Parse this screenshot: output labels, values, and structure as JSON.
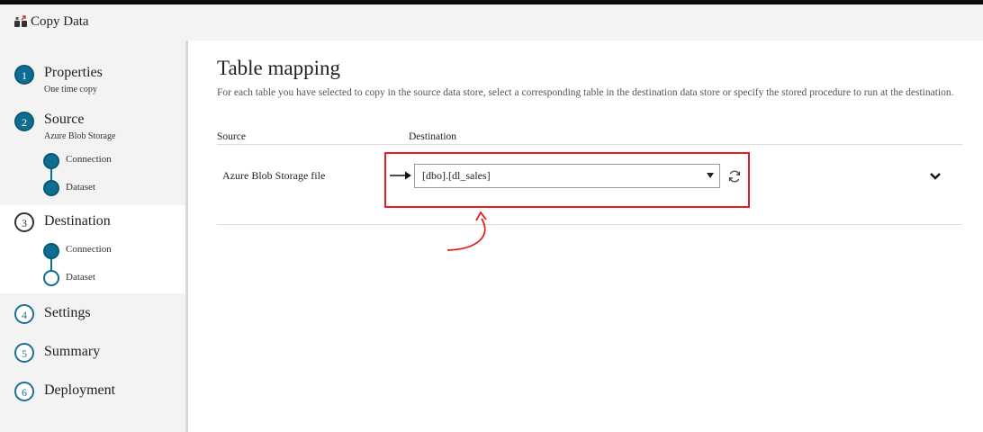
{
  "app": {
    "title": "Copy Data",
    "icon": "copy-data-icon"
  },
  "steps": [
    {
      "number": "1",
      "label": "Properties",
      "sub": "One time copy",
      "state": "complete"
    },
    {
      "number": "2",
      "label": "Source",
      "sub": "Azure Blob Storage",
      "state": "complete",
      "substeps": [
        {
          "label": "Connection",
          "state": "complete"
        },
        {
          "label": "Dataset",
          "state": "complete"
        }
      ]
    },
    {
      "number": "3",
      "label": "Destination",
      "sub": "",
      "state": "current",
      "substeps": [
        {
          "label": "Connection",
          "state": "complete"
        },
        {
          "label": "Dataset",
          "state": "current"
        }
      ]
    },
    {
      "number": "4",
      "label": "Settings",
      "state": "pending"
    },
    {
      "number": "5",
      "label": "Summary",
      "state": "pending"
    },
    {
      "number": "6",
      "label": "Deployment",
      "state": "pending"
    }
  ],
  "main": {
    "title": "Table mapping",
    "description": "For each table you have selected to copy in the source data store, select a corresponding table in the destination data store or specify the stored procedure to run at the destination.",
    "columns": {
      "source": "Source",
      "destination": "Destination"
    },
    "rows": [
      {
        "source": "Azure Blob Storage file",
        "destination": "[dbo].[dl_sales]"
      }
    ]
  },
  "colors": {
    "accent": "#0d6e8f",
    "highlight": "#e02020"
  }
}
